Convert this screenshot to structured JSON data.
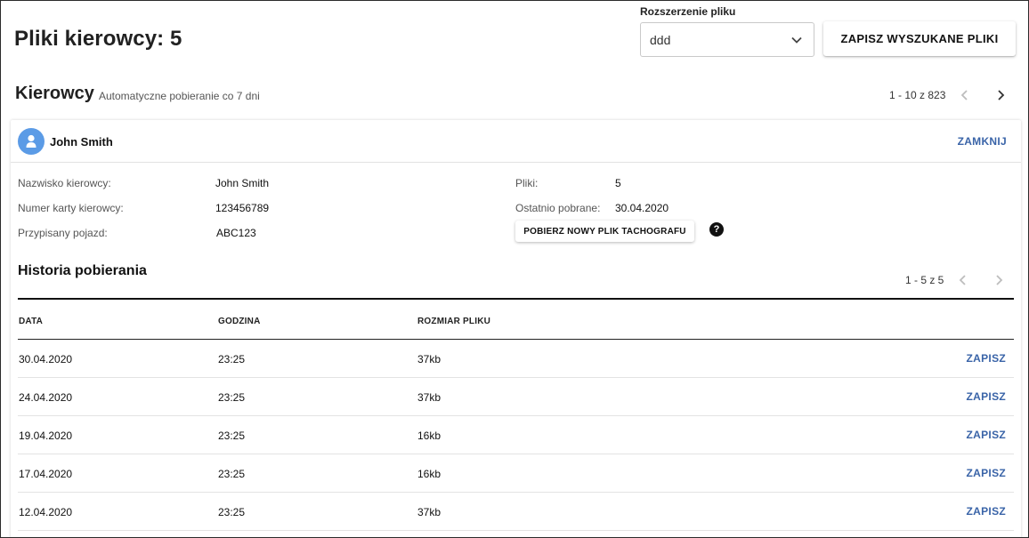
{
  "header": {
    "title": "Pliki kierowcy: 5",
    "extension_label": "Rozszerzenie pliku",
    "extension_value": "ddd",
    "save_found_label": "ZAPISZ WYSZUKANE PLIKI"
  },
  "drivers": {
    "title": "Kierowcy",
    "subtitle": "Automatyczne pobieranie co 7 dni",
    "pager_text": "1 - 10 z 823"
  },
  "driver_card": {
    "name": "John Smith",
    "close_label": "ZAMKNIJ",
    "fields": {
      "surname_label": "Nazwisko kierowcy:",
      "surname_value": "John Smith",
      "card_label": "Numer karty kierowcy:",
      "card_value": "123456789",
      "vehicle_label": "Przypisany pojazd:",
      "vehicle_value": "ABC123",
      "files_label": "Pliki:",
      "files_value": "5",
      "last_label": "Ostatnio pobrane:",
      "last_value": "30.04.2020"
    },
    "tacho_button_label": "POBIERZ NOWY PLIK TACHOGRAFU",
    "help_glyph": "?"
  },
  "history": {
    "title": "Historia pobierania",
    "pager_text": "1 - 5 z 5",
    "columns": [
      "DATA",
      "GODZINA",
      "ROZMIAR PLIKU"
    ],
    "rows": [
      {
        "date": "30.04.2020",
        "time": "23:25",
        "size": "37kb",
        "action": "ZAPISZ"
      },
      {
        "date": "24.04.2020",
        "time": "23:25",
        "size": "37kb",
        "action": "ZAPISZ"
      },
      {
        "date": "19.04.2020",
        "time": "23:25",
        "size": "16kb",
        "action": "ZAPISZ"
      },
      {
        "date": "17.04.2020",
        "time": "23:25",
        "size": "16kb",
        "action": "ZAPISZ"
      },
      {
        "date": "12.04.2020",
        "time": "23:25",
        "size": "37kb",
        "action": "ZAPISZ"
      }
    ]
  },
  "colors": {
    "link_blue": "#3a64a8",
    "avatar_blue": "#5b9be6"
  },
  "icons": [
    "chevron-down-icon",
    "chevron-left-icon",
    "chevron-right-icon",
    "user-icon",
    "help-icon"
  ]
}
